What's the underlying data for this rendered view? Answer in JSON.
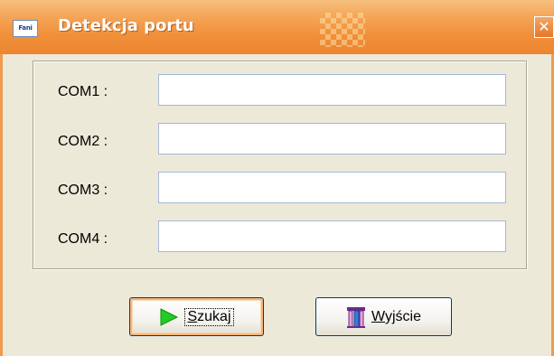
{
  "window": {
    "title": "Detekcja portu",
    "app_icon_text": "Fani"
  },
  "ports": [
    {
      "label": "COM1 :",
      "value": ""
    },
    {
      "label": "COM2 :",
      "value": ""
    },
    {
      "label": "COM3 :",
      "value": ""
    },
    {
      "label": "COM4 :",
      "value": ""
    }
  ],
  "buttons": {
    "search": {
      "mnemonic": "S",
      "rest": "zukaj",
      "icon": "play-arrow-icon"
    },
    "exit": {
      "mnemonic": "W",
      "rest": "yjście",
      "icon": "exit-door-icon"
    }
  },
  "colors": {
    "titlebar": "#f08f3a",
    "frame": "#f09a4e",
    "dialog_bg": "#ece9d8",
    "play_green": "#22cc22"
  }
}
